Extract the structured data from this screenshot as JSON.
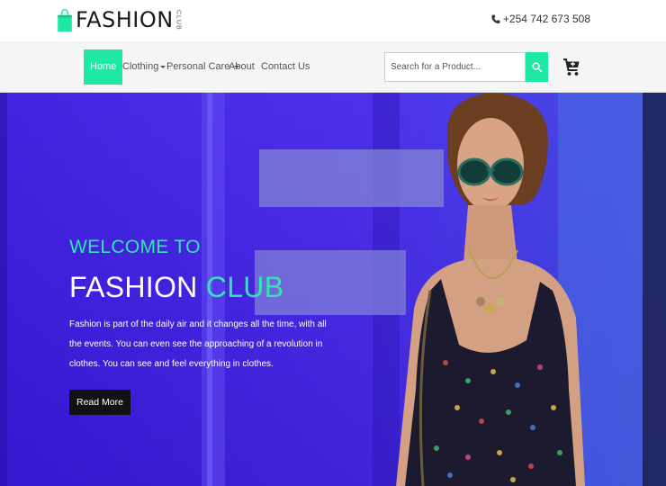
{
  "brand": {
    "name": "FASHION",
    "sub": "CLUB",
    "bag_color": "#1de9a3"
  },
  "contact": {
    "phone": "+254 742 673 508",
    "icon": "phone-icon"
  },
  "nav": {
    "items": [
      {
        "label": "Home",
        "active": true,
        "dropdown": false
      },
      {
        "label": "Clothing",
        "active": false,
        "dropdown": true
      },
      {
        "label": "Personal Care",
        "active": false,
        "dropdown": true
      },
      {
        "label": "About",
        "active": false,
        "dropdown": false
      },
      {
        "label": "Contact Us",
        "active": false,
        "dropdown": false
      }
    ],
    "accent": "#1de9a3"
  },
  "search": {
    "placeholder": "Search for a Product...",
    "value": "",
    "button_icon": "search-icon"
  },
  "cart": {
    "icon": "shopping-cart-icon"
  },
  "hero": {
    "welcome": "WELCOME TO",
    "title_main": "FASHION",
    "title_accent": "CLUB",
    "description": "Fashion is part of the daily air and it changes all the time, with all the events. You can even see the approaching of a revolution in clothes. You can see and feel everything in clothes.",
    "button_label": "Read More",
    "accent": "#2ee8b0",
    "background": "#3a1bd9"
  }
}
